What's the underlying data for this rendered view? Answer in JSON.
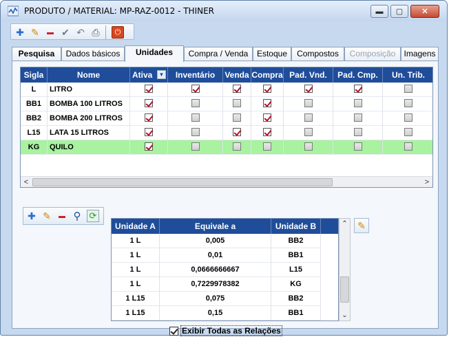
{
  "window": {
    "title": "PRODUTO / MATERIAL: MP-RAZ-0012 - THINER"
  },
  "window_controls": {
    "minimize": "▬",
    "maximize": "▢",
    "close": "✕"
  },
  "toolbar": {
    "icons": [
      "plus-icon",
      "pencil-icon",
      "minus-icon",
      "check-icon",
      "undo-icon",
      "print-icon",
      "power-icon"
    ],
    "glyphs": {
      "add": "✚",
      "edit": "✎",
      "delete": "▬",
      "save": "✔",
      "undo": "↶",
      "print": "⎙",
      "exit": "⏻"
    }
  },
  "tabs": [
    {
      "label": "Pesquisa",
      "state": "bold"
    },
    {
      "label": "Dados básicos",
      "state": "normal"
    },
    {
      "label": "Unidades",
      "state": "active"
    },
    {
      "label": "Compra / Venda",
      "state": "normal"
    },
    {
      "label": "Estoque",
      "state": "normal"
    },
    {
      "label": "Compostos",
      "state": "normal"
    },
    {
      "label": "Composição",
      "state": "disabled"
    },
    {
      "label": "Imagens",
      "state": "normal"
    }
  ],
  "units_grid": {
    "columns": [
      "Sigla",
      "Nome",
      "Ativa",
      "Inventário",
      "Venda",
      "Compra",
      "Pad. Vnd.",
      "Pad. Cmp.",
      "Un. Trib."
    ],
    "filter_glyph": "▼",
    "rows": [
      {
        "sigla": "L",
        "nome": "LITRO",
        "flags": [
          true,
          true,
          true,
          true,
          true,
          true,
          false
        ]
      },
      {
        "sigla": "BB1",
        "nome": "BOMBA 100 LITROS",
        "flags": [
          true,
          false,
          false,
          true,
          false,
          false,
          false
        ]
      },
      {
        "sigla": "BB2",
        "nome": "BOMBA 200 LITROS",
        "flags": [
          true,
          false,
          false,
          true,
          false,
          false,
          false
        ]
      },
      {
        "sigla": "L15",
        "nome": "LATA 15 LITROS",
        "flags": [
          true,
          false,
          true,
          true,
          false,
          false,
          false
        ]
      },
      {
        "sigla": "KG",
        "nome": "QUILO",
        "flags": [
          true,
          false,
          false,
          false,
          false,
          false,
          false
        ],
        "selected": true
      }
    ],
    "scroll_left": "<",
    "scroll_right": ">"
  },
  "sub_toolbar": {
    "icons": [
      "plus-icon",
      "pencil-icon",
      "minus-icon",
      "search-icon",
      "refresh-icon"
    ],
    "glyphs": {
      "add": "✚",
      "edit": "✎",
      "delete": "▬",
      "find": "⚲",
      "refresh": "⟳"
    }
  },
  "relations_grid": {
    "columns": [
      "Unidade A",
      "Equivale a",
      "Unidade B"
    ],
    "rows": [
      [
        "1 L",
        "0,005",
        "BB2"
      ],
      [
        "1 L",
        "0,01",
        "BB1"
      ],
      [
        "1 L",
        "0,0666666667",
        "L15"
      ],
      [
        "1 L",
        "0,7229978382",
        "KG"
      ],
      [
        "1 L15",
        "0,075",
        "BB2"
      ],
      [
        "1 L15",
        "0,15",
        "BB1"
      ]
    ],
    "scroll_up": "⌃",
    "scroll_down": "⌄"
  },
  "edit_relation_glyph": "✎",
  "show_all_checkbox": {
    "label": "Exibir Todas as Relações",
    "checked": true
  },
  "colors": {
    "header_bg": "#1f4d9a",
    "selected_row": "#a8f2a0",
    "window_bg": "#c7d9ee",
    "check_red": "#b0102a"
  }
}
